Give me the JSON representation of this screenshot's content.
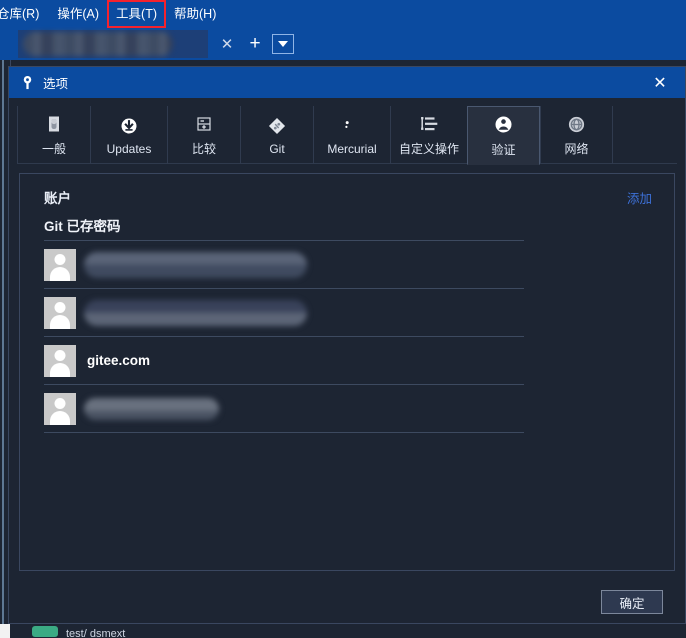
{
  "app": {
    "menu": [
      {
        "label": "仓库(R)",
        "name": "menu-repository",
        "highlight": false
      },
      {
        "label": "操作(A)",
        "name": "menu-actions",
        "highlight": false
      },
      {
        "label": "工具(T)",
        "name": "menu-tools",
        "highlight": true
      },
      {
        "label": "帮助(H)",
        "name": "menu-help",
        "highlight": false
      }
    ],
    "tabstrip": {
      "tab_label_redacted": "",
      "close_glyph": "✕",
      "add_glyph": "+",
      "dropdown_name": "tab-list-dropdown"
    },
    "background": {
      "status_text": "test/ dsmext"
    },
    "colors": {
      "titlebar_blue": "#0b4ba0",
      "window_bg": "#1d2533",
      "panel_border": "#3a4760",
      "link_blue": "#3d71d8",
      "highlight_red": "#f5222d",
      "accent_green": "#3bab84"
    }
  },
  "dialog": {
    "title": "选项",
    "icon": "key-icon",
    "close_glyph": "✕",
    "tabs": [
      {
        "label": "一般",
        "icon": "general-icon",
        "selected": false
      },
      {
        "label": "Updates",
        "icon": "download-icon",
        "selected": false
      },
      {
        "label": "比较",
        "icon": "compare-icon",
        "selected": false
      },
      {
        "label": "Git",
        "icon": "git-icon",
        "selected": false
      },
      {
        "label": "Mercurial",
        "icon": "mercurial-icon",
        "selected": false
      },
      {
        "label": "自定义操作",
        "icon": "custom-actions-icon",
        "selected": false
      },
      {
        "label": "验证",
        "icon": "person-auth-icon",
        "selected": true
      },
      {
        "label": "网络",
        "icon": "globe-icon",
        "selected": false
      }
    ],
    "content": {
      "accounts_heading": "账户",
      "add_link": "添加",
      "section_heading": "Git 已存密码",
      "rows": [
        {
          "name": "",
          "redacted": true,
          "blur_class": "b1"
        },
        {
          "name": "",
          "redacted": true,
          "blur_class": "b2"
        },
        {
          "name": "gitee.com",
          "redacted": false,
          "blur_class": ""
        },
        {
          "name": "",
          "redacted": true,
          "blur_class": "b4"
        }
      ]
    },
    "footer": {
      "ok_label": "确定"
    }
  }
}
